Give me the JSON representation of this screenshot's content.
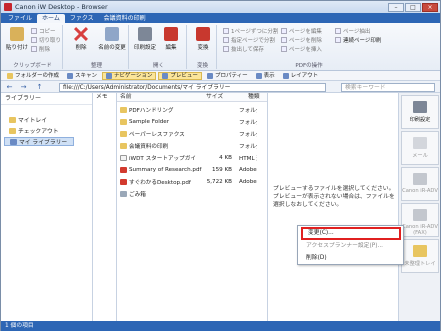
{
  "window": {
    "title": "Canon iW Desktop - Browser",
    "min": "–",
    "max": "□",
    "close": "×"
  },
  "tabs": [
    "ファイル",
    "ホーム",
    "ファクス",
    "会議資料の印刷"
  ],
  "ribbon": {
    "groups": [
      "クリップボード",
      "整理",
      "開く",
      "変換",
      "PDFの操作"
    ],
    "paste": "貼り付け",
    "copy": "コピー",
    "cut": "切り取り",
    "delete_small": "削除",
    "delete": "削除",
    "rename": "名前の変更",
    "print_settings": "印刷設定",
    "edit": "編集",
    "convert": "変換",
    "page_ops": [
      "1ページずつに分割",
      "指定ページで分割",
      "抜出して保存",
      "ページ抽出",
      "ページ削除",
      "ページ挿入"
    ],
    "page_edit": "ページを編集",
    "page_remove": "ページを削除",
    "page_insert": "ページを挿入",
    "join": "連続ページ印刷"
  },
  "infobar": {
    "folder_ops": "フォルダーの作成",
    "scan": "スキャン",
    "navigation": "ナビゲーション",
    "preview": "プレビュー",
    "properties": "プロパティー",
    "view": "表示",
    "layout": "レイアウト"
  },
  "address": {
    "back": "←",
    "forward": "→",
    "up": "↑",
    "path": "file:///C:/Users/Administrator/Documents/マイ ライブラリー",
    "search_placeholder": "検索キーワード"
  },
  "left_pane": {
    "header": "ライブラリー",
    "items": [
      "マイトレイ",
      "チェックアウト",
      "マイ ライブラリー"
    ]
  },
  "columns": {
    "memo": "メモ",
    "name": "名前",
    "size": "サイズ",
    "type": "種類"
  },
  "files": [
    {
      "name": "PDFハンドリング",
      "size": "",
      "type": "フォルダー"
    },
    {
      "name": "Sample Folder",
      "size": "",
      "type": "フォルダー"
    },
    {
      "name": "ペーパーレスファクス",
      "size": "",
      "type": "フォルダー"
    },
    {
      "name": "会議資料の印刷",
      "size": "",
      "type": "フォルダー"
    },
    {
      "name": "iWDT スタートアップガイ",
      "size": "4 KB",
      "type": "HTML 形式"
    },
    {
      "name": "Summary of Research.pdf",
      "size": "159 KB",
      "type": "Adobe"
    },
    {
      "name": "すぐわかるDesktop.pdf",
      "size": "5,722 KB",
      "type": "Adobe"
    },
    {
      "name": "ごみ箱",
      "size": "",
      "type": ""
    }
  ],
  "preview": {
    "message": "プレビューするファイルを選択してください。プレビューが表示されない場合は、ファイルを選択しなおしてください。"
  },
  "context_menu": {
    "items": [
      "変更(C)...",
      "アクセスプランナー設定(P)...",
      "削除(D)"
    ]
  },
  "right_pane": {
    "buttons": [
      "印刷設定",
      "メール",
      "Canon iR-ADV",
      "Canon iR-ADV (FAX)",
      "未整理トレイ"
    ]
  },
  "status": {
    "text": "1 個の項目"
  },
  "colors": {
    "accent": "#2d66b5",
    "highlight": "#e02020"
  }
}
